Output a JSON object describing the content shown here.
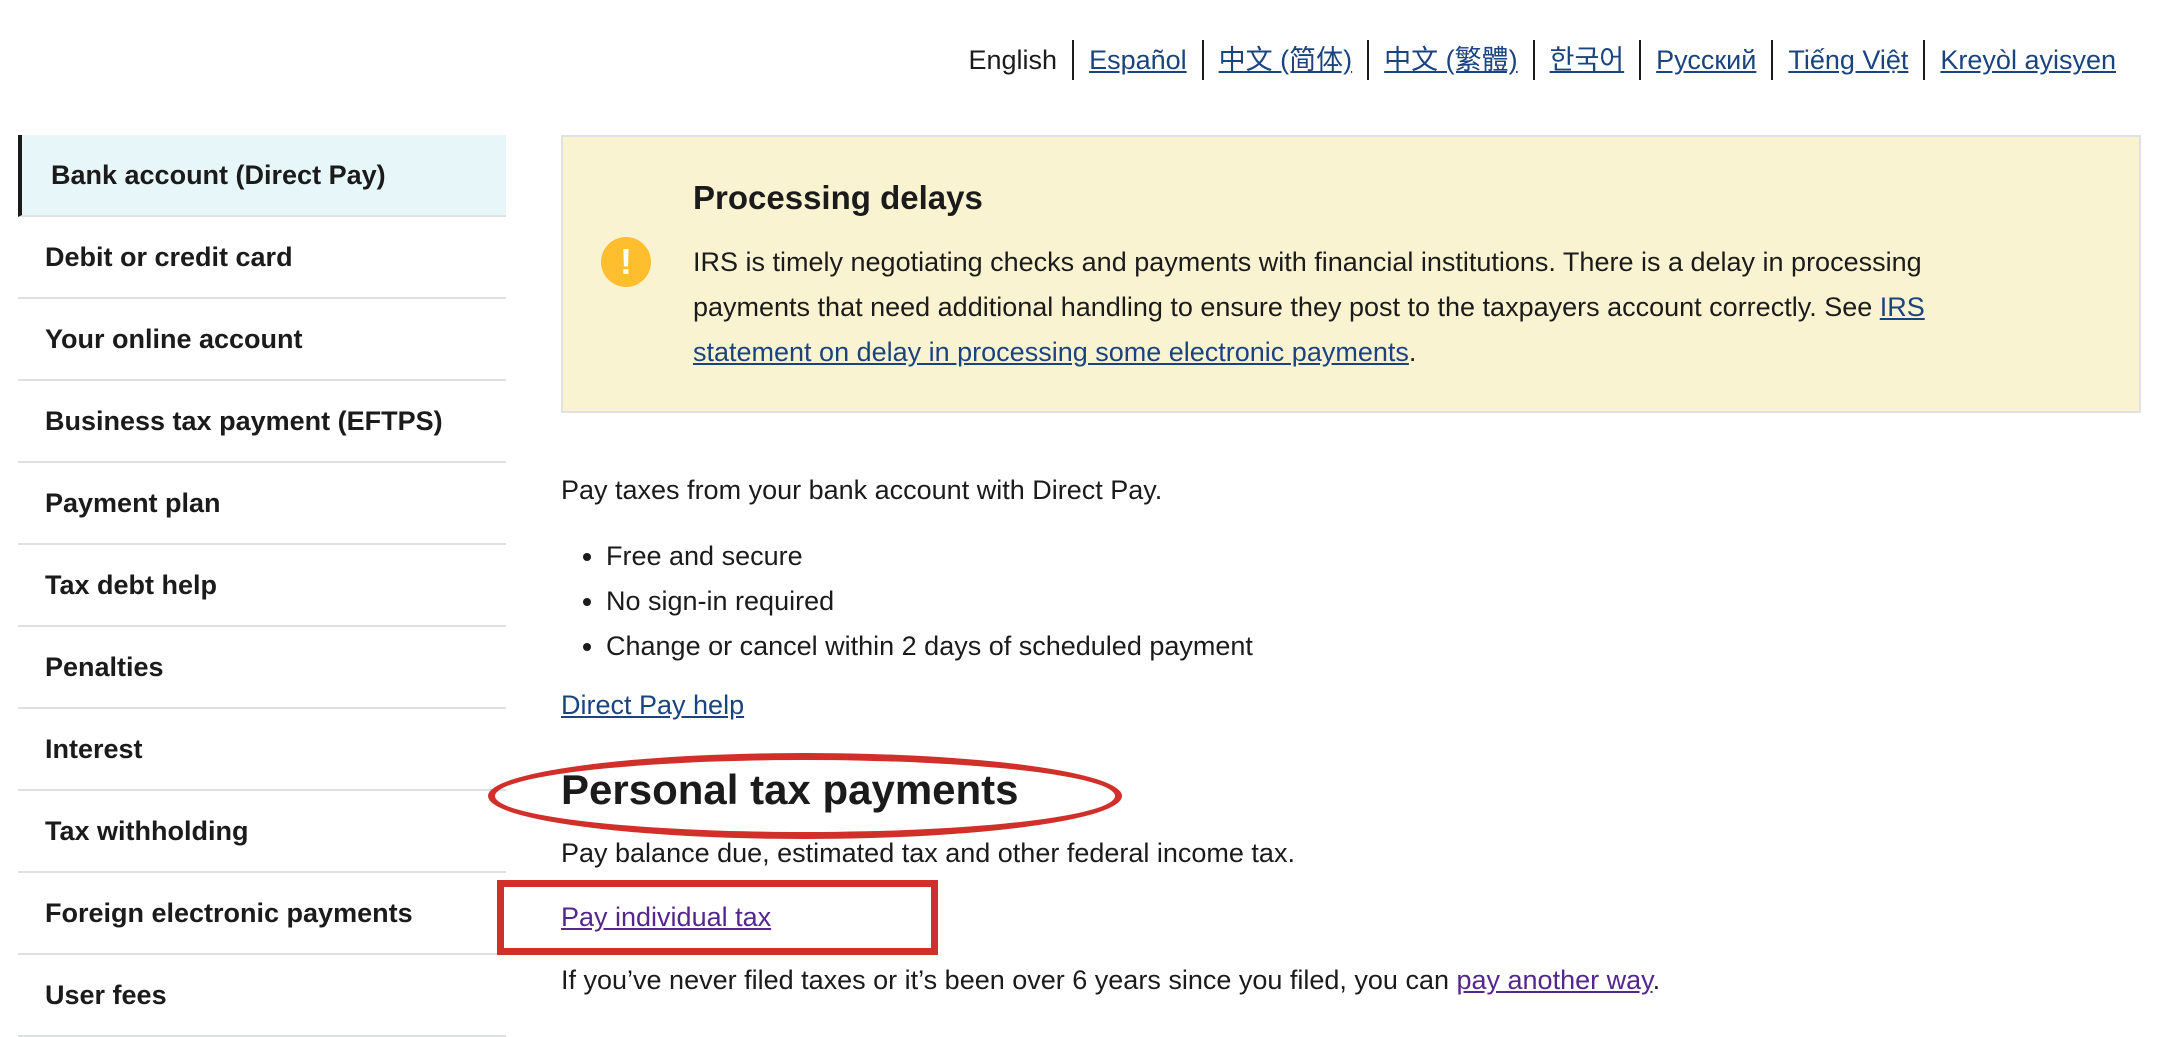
{
  "languages": [
    {
      "label": "English"
    },
    {
      "label": "Español"
    },
    {
      "label": "中文 (简体)"
    },
    {
      "label": "中文 (繁體)"
    },
    {
      "label": "한국어"
    },
    {
      "label": "Русский"
    },
    {
      "label": "Tiếng Việt"
    },
    {
      "label": "Kreyòl ayisyen"
    }
  ],
  "sidebar": {
    "items": [
      {
        "label": "Bank account (Direct Pay)"
      },
      {
        "label": "Debit or credit card"
      },
      {
        "label": "Your online account"
      },
      {
        "label": "Business tax payment (EFTPS)"
      },
      {
        "label": "Payment plan"
      },
      {
        "label": "Tax debt help"
      },
      {
        "label": "Penalties"
      },
      {
        "label": "Interest"
      },
      {
        "label": "Tax withholding"
      },
      {
        "label": "Foreign electronic payments"
      },
      {
        "label": "User fees"
      }
    ]
  },
  "alert": {
    "icon_glyph": "!",
    "title": "Processing delays",
    "body_text": "IRS is timely negotiating checks and payments with financial institutions. There is a delay in processing payments that need additional handling to ensure they post to the taxpayers account correctly. See ",
    "link_text": "IRS statement on delay in processing some electronic payments",
    "body_end": "."
  },
  "main": {
    "intro": "Pay taxes from your bank account with Direct Pay.",
    "bullets": [
      "Free and secure",
      "No sign-in required",
      "Change or cancel within 2 days of scheduled payment"
    ],
    "help_link": "Direct Pay help",
    "section_heading": "Personal tax payments",
    "section_desc": "Pay balance due, estimated tax and other federal income tax.",
    "pay_link": "Pay individual tax",
    "never_filed_text": "If you’ve never filed taxes or it’s been over 6 years since you filed, you can ",
    "never_filed_link": "pay another way",
    "never_filed_end": "."
  },
  "colors": {
    "link": "#1a4480",
    "visited_link": "#54278f",
    "alert_background": "#faf3d1",
    "alert_icon": "#ffbe2e",
    "active_nav": "#e7f6f8",
    "annotation": "#d1302a"
  }
}
